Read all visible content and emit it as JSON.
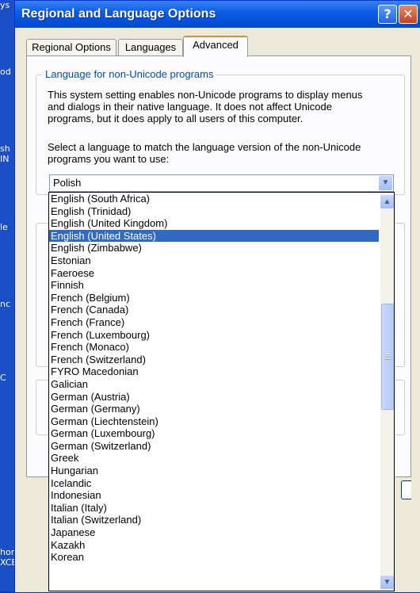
{
  "window": {
    "title": "Regional and Language Options",
    "help_label": "?",
    "close_label": "✕"
  },
  "tabs": [
    {
      "label": "Regional Options"
    },
    {
      "label": "Languages"
    },
    {
      "label": "Advanced"
    }
  ],
  "non_unicode": {
    "group_title": "Language for non-Unicode programs",
    "description_lines": [
      "This system setting enables non-Unicode programs to display menus",
      "and dialogs in their native language. It does not affect Unicode",
      "programs, but it does apply to all users of this computer."
    ],
    "prompt_lines": [
      "Select a language to match the language version of the non-Unicode",
      "programs you want to use:"
    ],
    "selected_value": "Polish"
  },
  "language_list": {
    "highlighted": "English (United States)",
    "items": [
      "English (South Africa)",
      "English (Trinidad)",
      "English (United Kingdom)",
      "English (United States)",
      "English (Zimbabwe)",
      "Estonian",
      "Faeroese",
      "Finnish",
      "French (Belgium)",
      "French (Canada)",
      "French (France)",
      "French (Luxembourg)",
      "French (Monaco)",
      "French (Switzerland)",
      "FYRO Macedonian",
      "Galician",
      "German (Austria)",
      "German (Germany)",
      "German (Liechtenstein)",
      "German (Luxembourg)",
      "German (Switzerland)",
      "Greek",
      "Hungarian",
      "Icelandic",
      "Indonesian",
      "Italian (Italy)",
      "Italian (Switzerland)",
      "Japanese",
      "Kazakh",
      "Korean"
    ]
  },
  "desktop": {
    "fragments": [
      "ys",
      "od",
      "sh",
      "IN",
      "le",
      "nc",
      "C"
    ],
    "excel_label_1": "hortcut t",
    "excel_label_2": "XCEL.EX"
  },
  "colors": {
    "titlebar": "#0a5ce4",
    "selection": "#316ac5",
    "group_title": "#0046d5",
    "active_tab_accent": "#e68b2c"
  }
}
